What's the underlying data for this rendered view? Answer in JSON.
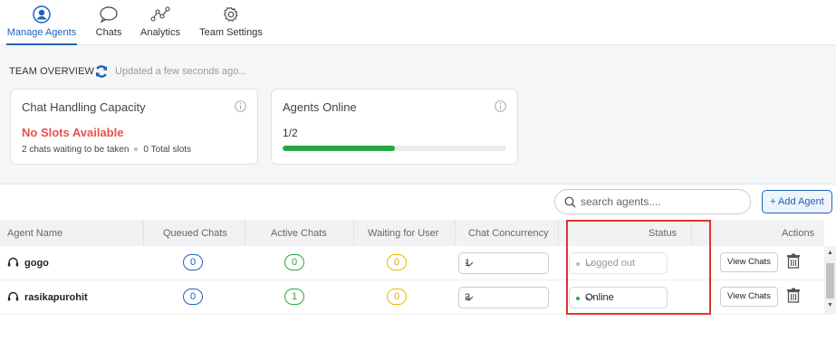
{
  "nav": {
    "items": [
      {
        "label": "Manage Agents",
        "icon": "agent-avatar-icon",
        "active": true
      },
      {
        "label": "Chats",
        "icon": "chat-bubble-icon",
        "active": false
      },
      {
        "label": "Analytics",
        "icon": "analytics-graph-icon",
        "active": false
      },
      {
        "label": "Team Settings",
        "icon": "gear-icon",
        "active": false
      }
    ]
  },
  "overview": {
    "title": "TEAM OVERVIEW",
    "updated": "Updated a few seconds ago..."
  },
  "capacity_card": {
    "title": "Chat Handling Capacity",
    "status": "No Slots Available",
    "waiting": "2 chats waiting to be taken",
    "total_slots": "0 Total slots"
  },
  "agents_card": {
    "title": "Agents Online",
    "ratio": "1/2",
    "progress_fraction": 0.5
  },
  "toolbar": {
    "search_placeholder": "search agents....",
    "add_agent_label": "+ Add Agent"
  },
  "table": {
    "columns": [
      "Agent Name",
      "Queued Chats",
      "Active Chats",
      "Waiting for User",
      "Chat Concurrency",
      "Status",
      "Actions"
    ],
    "rows": [
      {
        "name": "gogo",
        "queued": "0",
        "active": "0",
        "waiting": "0",
        "concurrency": "1",
        "status": "Logged out",
        "view_label": "View Chats"
      },
      {
        "name": "rasikapurohit",
        "queued": "0",
        "active": "1",
        "waiting": "0",
        "concurrency": "3",
        "status": "Online",
        "view_label": "View Chats"
      }
    ]
  },
  "colors": {
    "accent": "#1e63b8",
    "online": "#27a844",
    "alert": "#e5534b",
    "highlight_box": "#e0352b",
    "waiting_badge": "#f2b705"
  }
}
